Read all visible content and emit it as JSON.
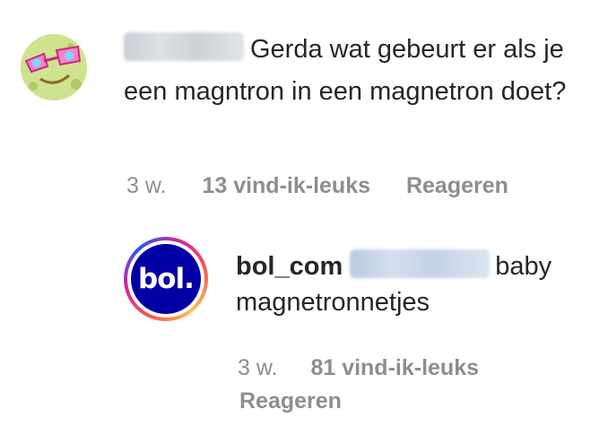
{
  "comment": {
    "avatar_icon": "spongebob-glasses-avatar-icon",
    "text": "Gerda wat gebeurt er als je een magntron in een magnetron doet?",
    "time": "3 w.",
    "likes": "13 vind-ik-leuks",
    "reply_label": "Reageren"
  },
  "reply": {
    "avatar_text": "bol.",
    "username": "bol_com",
    "text": "baby magnetronnetjes",
    "time": "3 w.",
    "likes": "81 vind-ik-leuks",
    "reply_label": "Reageren",
    "colors": {
      "brand": "#0000a4",
      "story_ring": "#d6249f"
    }
  }
}
